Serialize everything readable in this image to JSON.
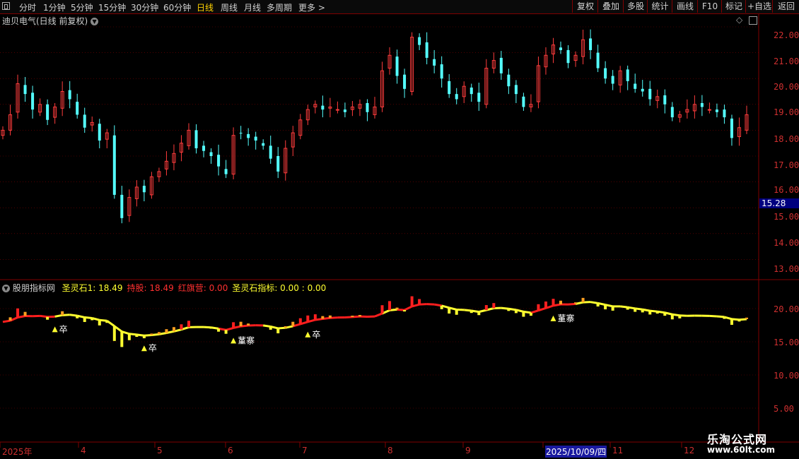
{
  "toolbar": {
    "timeframes": [
      "分时",
      "1分钟",
      "5分钟",
      "15分钟",
      "30分钟",
      "60分钟",
      "日线",
      "周线",
      "月线",
      "多周期",
      "更多 >"
    ],
    "active_timeframe": "日线",
    "buttons": [
      "复权",
      "叠加",
      "多股",
      "统计",
      "画线",
      "F10",
      "标记",
      "+自选",
      "返回"
    ]
  },
  "main_chart": {
    "title": "迪贝电气(日线 前复权)",
    "price_labels": [
      "22.00",
      "21.00",
      "20.00",
      "19.00",
      "18.00",
      "17.00",
      "16.00",
      "15.00",
      "14.00",
      "13.00"
    ],
    "current_price_tag": "15.28"
  },
  "indicator": {
    "name": "股朋指标网",
    "items": [
      {
        "label": "圣灵石1: 18.49",
        "color": "#ffff30"
      },
      {
        "label": "持股: 18.49",
        "color": "#ff3030"
      },
      {
        "label": "红旗营: 0.00",
        "color": "#ff3030"
      },
      {
        "label": "圣灵石指标: 0.00 : 0.00",
        "color": "#ffff30"
      }
    ],
    "labels": [
      "20.00",
      "15.00",
      "10.00",
      "5.00"
    ],
    "signals": [
      {
        "text": "卒",
        "idx": 7
      },
      {
        "text": "卒",
        "idx": 19
      },
      {
        "text": "蓳寨",
        "idx": 31
      },
      {
        "text": "卒",
        "idx": 41
      },
      {
        "text": "蓳寨",
        "idx": 74
      }
    ]
  },
  "x_axis": {
    "labels": [
      "2025年",
      "4",
      "5",
      "6",
      "7",
      "8",
      "9",
      "2025/10/09/四",
      "11",
      "12"
    ],
    "cursor_label": "2025/10/09/四"
  },
  "watermark": {
    "line1": "乐淘公式网",
    "line2": "www.60lt.com"
  },
  "colors": {
    "up": "#ff3c3c",
    "down": "#54ffff",
    "grid": "#800000",
    "yellow": "#ffff30",
    "red_line": "#ff1e1e"
  },
  "chart_data": {
    "type": "candlestick",
    "title": "迪贝电气(日线 前复权)",
    "x_labels": [
      "2025年",
      "4",
      "5",
      "6",
      "7",
      "8",
      "9",
      "10",
      "11",
      "12"
    ],
    "ylim": [
      12.8,
      22.4
    ],
    "closes": [
      18.0,
      18.6,
      19.8,
      19.4,
      18.8,
      19.0,
      18.4,
      18.9,
      19.5,
      19.2,
      18.6,
      18.1,
      18.3,
      17.6,
      17.9,
      15.5,
      14.6,
      15.4,
      15.8,
      15.6,
      16.2,
      16.4,
      16.8,
      17.1,
      17.5,
      18.0,
      17.3,
      17.2,
      17.0,
      16.6,
      16.3,
      17.8,
      17.9,
      17.7,
      17.6,
      17.4,
      16.9,
      16.4,
      17.3,
      17.9,
      18.4,
      18.8,
      19.0,
      18.8,
      18.9,
      18.8,
      18.7,
      18.9,
      19.0,
      18.7,
      18.9,
      20.3,
      20.9,
      20.1,
      19.6,
      21.6,
      21.3,
      20.8,
      20.5,
      20.0,
      19.4,
      19.2,
      19.7,
      19.4,
      19.1,
      20.4,
      20.7,
      20.2,
      19.7,
      19.4,
      18.9,
      19.0,
      20.5,
      20.9,
      21.3,
      21.1,
      20.6,
      20.9,
      21.5,
      21.1,
      20.4,
      20.0,
      19.8,
      20.3,
      19.9,
      19.6,
      19.5,
      19.2,
      19.3,
      19.0,
      18.5,
      18.6,
      18.8,
      19.0,
      18.9,
      18.8,
      18.7,
      18.5,
      17.7,
      18.1,
      18.6
    ],
    "indicator_ylim": [
      3,
      24
    ]
  }
}
